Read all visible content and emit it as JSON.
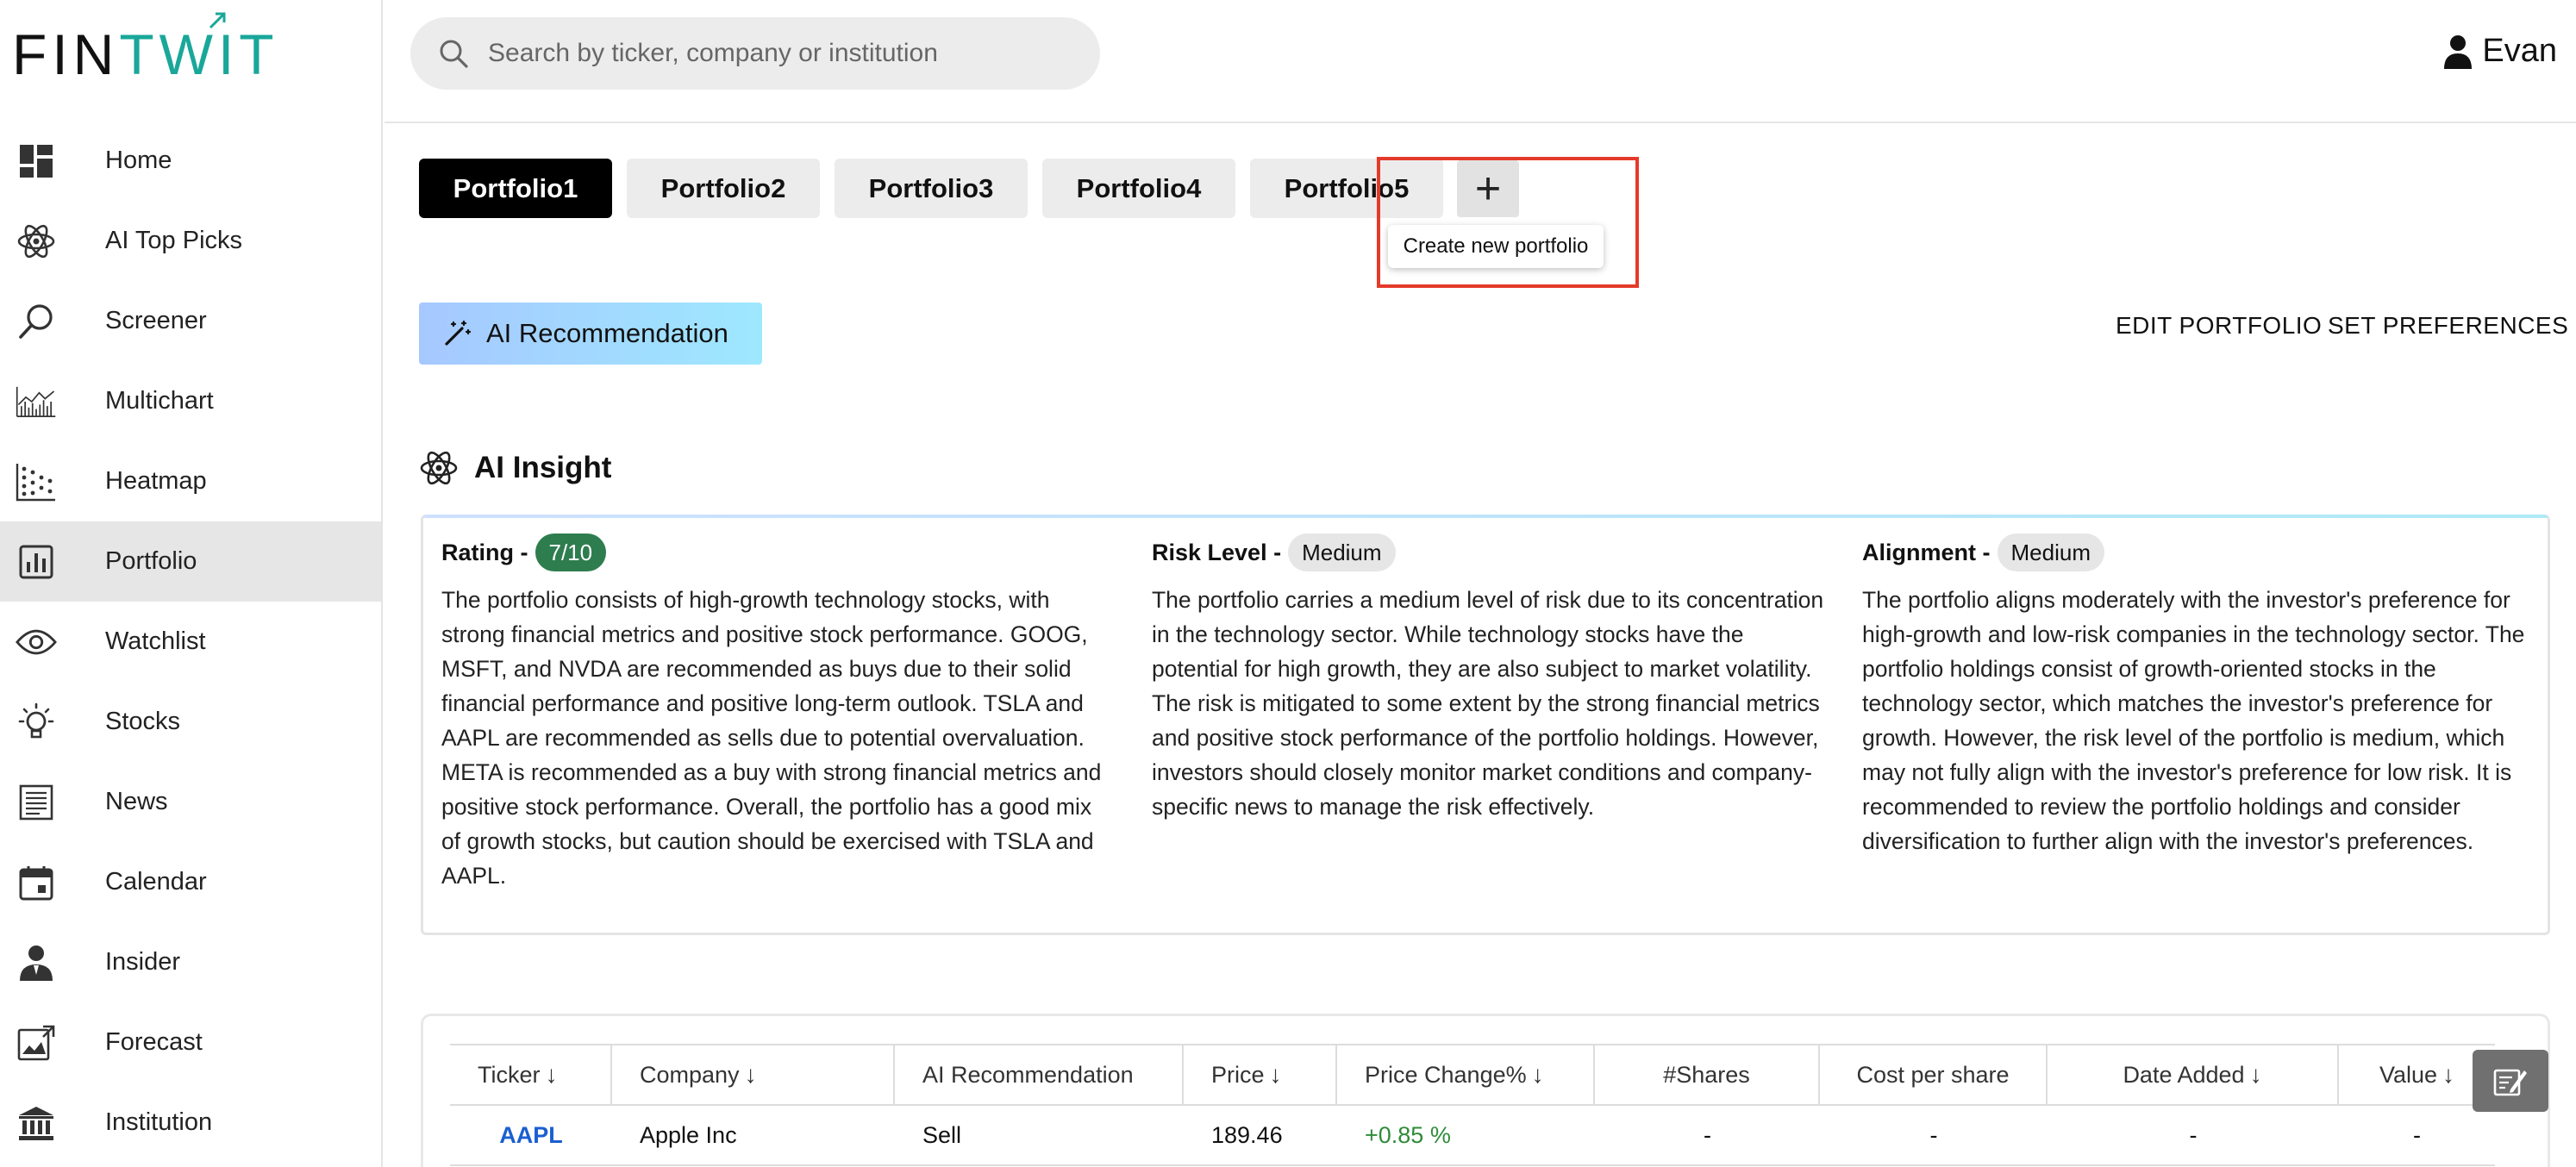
{
  "brand": {
    "fin": "FIN",
    "twit": "TWIT"
  },
  "sidebar": {
    "items": [
      {
        "label": "Home",
        "icon": "dashboard-icon"
      },
      {
        "label": "AI Top Picks",
        "icon": "atom-icon"
      },
      {
        "label": "Screener",
        "icon": "search-icon"
      },
      {
        "label": "Multichart",
        "icon": "chart-icon"
      },
      {
        "label": "Heatmap",
        "icon": "dots-grid-icon"
      },
      {
        "label": "Portfolio",
        "icon": "bar-chart-icon",
        "active": true
      },
      {
        "label": "Watchlist",
        "icon": "eye-icon"
      },
      {
        "label": "Stocks",
        "icon": "lightbulb-icon"
      },
      {
        "label": "News",
        "icon": "newspaper-icon"
      },
      {
        "label": "Calendar",
        "icon": "calendar-icon"
      },
      {
        "label": "Insider",
        "icon": "person-icon"
      },
      {
        "label": "Forecast",
        "icon": "image-chart-icon"
      },
      {
        "label": "Institution",
        "icon": "bank-icon"
      }
    ]
  },
  "search": {
    "placeholder": "Search by ticker, company or institution"
  },
  "user": {
    "name": "Evan"
  },
  "tabs": [
    {
      "label": "Portfolio1",
      "active": true
    },
    {
      "label": "Portfolio2"
    },
    {
      "label": "Portfolio3"
    },
    {
      "label": "Portfolio4"
    },
    {
      "label": "Portfolio5"
    }
  ],
  "add_tab": {
    "symbol": "+",
    "tooltip": "Create new portfolio"
  },
  "ai_recommendation": {
    "label": "AI Recommendation"
  },
  "actions": {
    "edit": "EDIT PORTFOLIO",
    "preferences": "SET PREFERENCES"
  },
  "insight": {
    "title": "AI Insight",
    "rating": {
      "label": "Rating -",
      "value": "7/10",
      "text": "The portfolio consists of high-growth technology stocks, with strong financial metrics and positive stock performance. GOOG, MSFT, and NVDA are recommended as buys due to their solid financial performance and positive long-term outlook. TSLA and AAPL are recommended as sells due to potential overvaluation. META is recommended as a buy with strong financial metrics and positive stock performance. Overall, the portfolio has a good mix of growth stocks, but caution should be exercised with TSLA and AAPL."
    },
    "risk": {
      "label": "Risk Level -",
      "value": "Medium",
      "text": "The portfolio carries a medium level of risk due to its concentration in the technology sector. While technology stocks have the potential for high growth, they are also subject to market volatility. The risk is mitigated to some extent by the strong financial metrics and positive stock performance of the portfolio holdings. However, investors should closely monitor market conditions and company-specific news to manage the risk effectively."
    },
    "alignment": {
      "label": "Alignment -",
      "value": "Medium",
      "text": "The portfolio aligns moderately with the investor's preference for high-growth and low-risk companies in the technology sector. The portfolio holdings consist of growth-oriented stocks in the technology sector, which matches the investor's preference for growth. However, the risk level of the portfolio is medium, which may not fully align with the investor's preference for low risk. It is recommended to review the portfolio holdings and consider diversification to further align with the investor's preferences."
    }
  },
  "table": {
    "columns": [
      "Ticker",
      "Company",
      "AI Recommendation",
      "Price",
      "Price Change%",
      "#Shares",
      "Cost per share",
      "Date Added",
      "Value"
    ],
    "sort_arrow": "↓",
    "rows": [
      {
        "ticker": "AAPL",
        "company": "Apple Inc",
        "recommendation": "Sell",
        "price": "189.46",
        "change": "+0.85 %",
        "shares": "-",
        "cost": "-",
        "date": "-",
        "value": "-"
      }
    ]
  },
  "colors": {
    "brand_teal": "#1aa79a",
    "highlight_red": "#e53a2a",
    "rating_green": "#2e7d4f",
    "ticker_blue": "#1a5fd0",
    "positive_green": "#2e8b3a"
  }
}
